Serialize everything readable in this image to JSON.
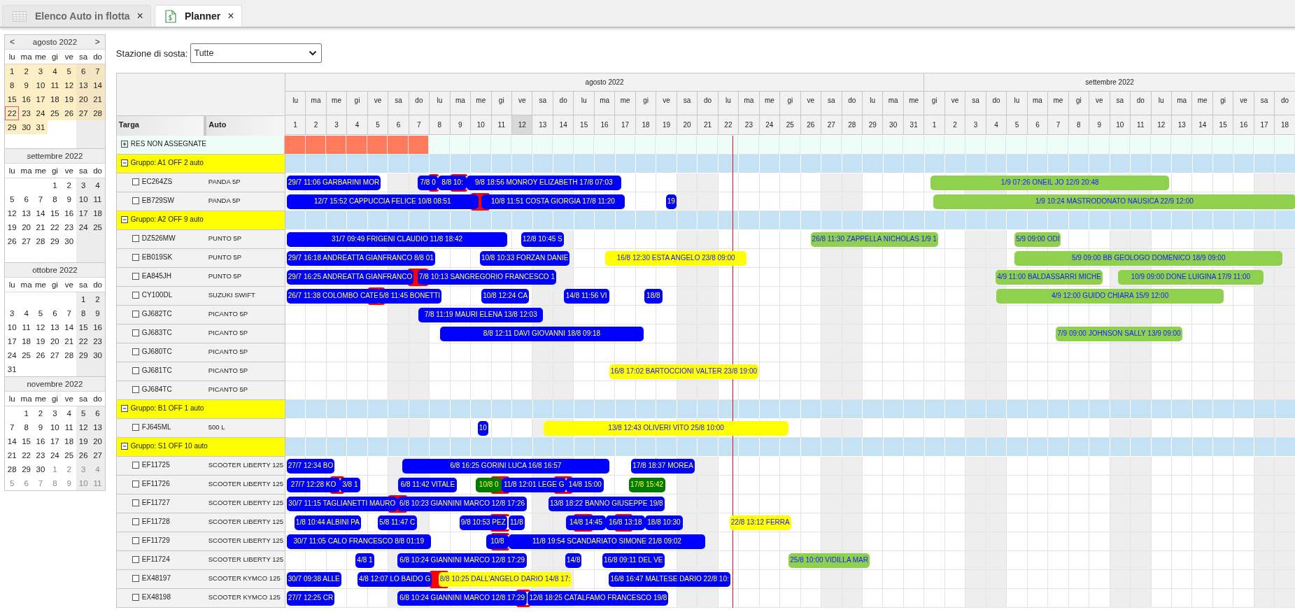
{
  "tabs": [
    {
      "label": "Elenco Auto in flotta",
      "kind": "table",
      "close": "×",
      "selected": false
    },
    {
      "label": "Planner",
      "kind": "sheet",
      "close": "×",
      "selected": true
    }
  ],
  "calendars": [
    {
      "title": "agosto 2022",
      "prev": "<",
      "next": ">",
      "highlighted": true,
      "weekdays": [
        "lu",
        "ma",
        "me",
        "gi",
        "ve",
        "sa",
        "do"
      ],
      "weeks": [
        [
          {
            "kind": "day",
            "day": "1"
          },
          {
            "kind": "day",
            "day": "2"
          },
          {
            "kind": "day",
            "day": "3"
          },
          {
            "kind": "day",
            "day": "4"
          },
          {
            "kind": "day",
            "day": "5"
          },
          {
            "kind": "day",
            "day": "6"
          },
          {
            "kind": "day",
            "day": "7"
          }
        ],
        [
          {
            "kind": "day",
            "day": "8"
          },
          {
            "kind": "day",
            "day": "9"
          },
          {
            "kind": "day",
            "day": "10"
          },
          {
            "kind": "day",
            "day": "11"
          },
          {
            "kind": "day",
            "day": "12"
          },
          {
            "kind": "day",
            "day": "13"
          },
          {
            "kind": "day",
            "day": "14"
          }
        ],
        [
          {
            "kind": "day",
            "day": "15"
          },
          {
            "kind": "day",
            "day": "16"
          },
          {
            "kind": "day",
            "day": "17"
          },
          {
            "kind": "day",
            "day": "18"
          },
          {
            "kind": "day",
            "day": "19"
          },
          {
            "kind": "day",
            "day": "20"
          },
          {
            "kind": "day",
            "day": "21"
          }
        ],
        [
          {
            "kind": "today",
            "day": "22"
          },
          {
            "kind": "day",
            "day": "23"
          },
          {
            "kind": "day",
            "day": "24"
          },
          {
            "kind": "day",
            "day": "25"
          },
          {
            "kind": "day",
            "day": "26"
          },
          {
            "kind": "day",
            "day": "27"
          },
          {
            "kind": "day",
            "day": "28"
          }
        ],
        [
          {
            "kind": "day",
            "day": "29"
          },
          {
            "kind": "day",
            "day": "30"
          },
          {
            "kind": "day",
            "day": "31"
          },
          {
            "kind": "blank"
          },
          {
            "kind": "blank"
          },
          {
            "kind": "blank"
          },
          {
            "kind": "blank"
          }
        ],
        [
          {
            "kind": "blank"
          },
          {
            "kind": "blank"
          },
          {
            "kind": "blank"
          },
          {
            "kind": "blank"
          },
          {
            "kind": "blank"
          },
          {
            "kind": "blank"
          },
          {
            "kind": "blank"
          }
        ]
      ]
    },
    {
      "title": "settembre 2022",
      "highlighted": false,
      "weekdays": [
        "lu",
        "ma",
        "me",
        "gi",
        "ve",
        "sa",
        "do"
      ],
      "weeks": [
        [
          {
            "kind": "blank"
          },
          {
            "kind": "blank"
          },
          {
            "kind": "blank"
          },
          {
            "kind": "day",
            "day": "1"
          },
          {
            "kind": "day",
            "day": "2"
          },
          {
            "kind": "day",
            "day": "3"
          },
          {
            "kind": "day",
            "day": "4"
          }
        ],
        [
          {
            "kind": "day",
            "day": "5"
          },
          {
            "kind": "day",
            "day": "6"
          },
          {
            "kind": "day",
            "day": "7"
          },
          {
            "kind": "day",
            "day": "8"
          },
          {
            "kind": "day",
            "day": "9"
          },
          {
            "kind": "day",
            "day": "10"
          },
          {
            "kind": "day",
            "day": "11"
          }
        ],
        [
          {
            "kind": "day",
            "day": "12"
          },
          {
            "kind": "day",
            "day": "13"
          },
          {
            "kind": "day",
            "day": "14"
          },
          {
            "kind": "day",
            "day": "15"
          },
          {
            "kind": "day",
            "day": "16"
          },
          {
            "kind": "day",
            "day": "17"
          },
          {
            "kind": "day",
            "day": "18"
          }
        ],
        [
          {
            "kind": "day",
            "day": "19"
          },
          {
            "kind": "day",
            "day": "20"
          },
          {
            "kind": "day",
            "day": "21"
          },
          {
            "kind": "day",
            "day": "22"
          },
          {
            "kind": "day",
            "day": "23"
          },
          {
            "kind": "day",
            "day": "24"
          },
          {
            "kind": "day",
            "day": "25"
          }
        ],
        [
          {
            "kind": "day",
            "day": "26"
          },
          {
            "kind": "day",
            "day": "27"
          },
          {
            "kind": "day",
            "day": "28"
          },
          {
            "kind": "day",
            "day": "29"
          },
          {
            "kind": "day",
            "day": "30"
          },
          {
            "kind": "blank"
          },
          {
            "kind": "blank"
          }
        ],
        [
          {
            "kind": "blank"
          },
          {
            "kind": "blank"
          },
          {
            "kind": "blank"
          },
          {
            "kind": "blank"
          },
          {
            "kind": "blank"
          },
          {
            "kind": "blank"
          },
          {
            "kind": "blank"
          }
        ]
      ]
    },
    {
      "title": "ottobre 2022",
      "highlighted": false,
      "weekdays": [
        "lu",
        "ma",
        "me",
        "gi",
        "ve",
        "sa",
        "do"
      ],
      "weeks": [
        [
          {
            "kind": "blank"
          },
          {
            "kind": "blank"
          },
          {
            "kind": "blank"
          },
          {
            "kind": "blank"
          },
          {
            "kind": "blank"
          },
          {
            "kind": "day",
            "day": "1"
          },
          {
            "kind": "day",
            "day": "2"
          }
        ],
        [
          {
            "kind": "day",
            "day": "3"
          },
          {
            "kind": "day",
            "day": "4"
          },
          {
            "kind": "day",
            "day": "5"
          },
          {
            "kind": "day",
            "day": "6"
          },
          {
            "kind": "day",
            "day": "7"
          },
          {
            "kind": "day",
            "day": "8"
          },
          {
            "kind": "day",
            "day": "9"
          }
        ],
        [
          {
            "kind": "day",
            "day": "10"
          },
          {
            "kind": "day",
            "day": "11"
          },
          {
            "kind": "day",
            "day": "12"
          },
          {
            "kind": "day",
            "day": "13"
          },
          {
            "kind": "day",
            "day": "14"
          },
          {
            "kind": "day",
            "day": "15"
          },
          {
            "kind": "day",
            "day": "16"
          }
        ],
        [
          {
            "kind": "day",
            "day": "17"
          },
          {
            "kind": "day",
            "day": "18"
          },
          {
            "kind": "day",
            "day": "19"
          },
          {
            "kind": "day",
            "day": "20"
          },
          {
            "kind": "day",
            "day": "21"
          },
          {
            "kind": "day",
            "day": "22"
          },
          {
            "kind": "day",
            "day": "23"
          }
        ],
        [
          {
            "kind": "day",
            "day": "24"
          },
          {
            "kind": "day",
            "day": "25"
          },
          {
            "kind": "day",
            "day": "26"
          },
          {
            "kind": "day",
            "day": "27"
          },
          {
            "kind": "day",
            "day": "28"
          },
          {
            "kind": "day",
            "day": "29"
          },
          {
            "kind": "day",
            "day": "30"
          }
        ],
        [
          {
            "kind": "day",
            "day": "31"
          },
          {
            "kind": "blank"
          },
          {
            "kind": "blank"
          },
          {
            "kind": "blank"
          },
          {
            "kind": "blank"
          },
          {
            "kind": "blank"
          },
          {
            "kind": "blank"
          }
        ]
      ]
    },
    {
      "title": "novembre 2022",
      "highlighted": false,
      "weekdays": [
        "lu",
        "ma",
        "me",
        "gi",
        "ve",
        "sa",
        "do"
      ],
      "weeks": [
        [
          {
            "kind": "blank"
          },
          {
            "kind": "day",
            "day": "1"
          },
          {
            "kind": "day",
            "day": "2"
          },
          {
            "kind": "day",
            "day": "3"
          },
          {
            "kind": "day",
            "day": "4"
          },
          {
            "kind": "day",
            "day": "5"
          },
          {
            "kind": "day",
            "day": "6"
          }
        ],
        [
          {
            "kind": "day",
            "day": "7"
          },
          {
            "kind": "day",
            "day": "8"
          },
          {
            "kind": "day",
            "day": "9"
          },
          {
            "kind": "day",
            "day": "10"
          },
          {
            "kind": "day",
            "day": "11"
          },
          {
            "kind": "day",
            "day": "12"
          },
          {
            "kind": "day",
            "day": "13"
          }
        ],
        [
          {
            "kind": "day",
            "day": "14"
          },
          {
            "kind": "day",
            "day": "15"
          },
          {
            "kind": "day",
            "day": "16"
          },
          {
            "kind": "day",
            "day": "17"
          },
          {
            "kind": "day",
            "day": "18"
          },
          {
            "kind": "day",
            "day": "19"
          },
          {
            "kind": "day",
            "day": "20"
          }
        ],
        [
          {
            "kind": "day",
            "day": "21"
          },
          {
            "kind": "day",
            "day": "22"
          },
          {
            "kind": "day",
            "day": "23"
          },
          {
            "kind": "day",
            "day": "24"
          },
          {
            "kind": "day",
            "day": "25"
          },
          {
            "kind": "day",
            "day": "26"
          },
          {
            "kind": "day",
            "day": "27"
          }
        ],
        [
          {
            "kind": "day",
            "day": "28"
          },
          {
            "kind": "day",
            "day": "29"
          },
          {
            "kind": "day",
            "day": "30"
          },
          {
            "kind": "other",
            "day": "1"
          },
          {
            "kind": "other",
            "day": "2"
          },
          {
            "kind": "other",
            "day": "3"
          },
          {
            "kind": "other",
            "day": "4"
          }
        ],
        [
          {
            "kind": "other",
            "day": "5"
          },
          {
            "kind": "other",
            "day": "6"
          },
          {
            "kind": "other",
            "day": "7"
          },
          {
            "kind": "other",
            "day": "8"
          },
          {
            "kind": "other",
            "day": "9"
          },
          {
            "kind": "other",
            "day": "10"
          },
          {
            "kind": "other",
            "day": "11"
          }
        ]
      ]
    }
  ],
  "filter": {
    "label": "Stazione di sosta:",
    "value": "Tutte"
  },
  "planner": {
    "columns": [
      "Targa",
      "Auto"
    ],
    "months": [
      {
        "label": "agosto 2022",
        "days": [
          {
            "weekday": "lu",
            "day": "1",
            "highlighted": false,
            "weekend": false
          },
          {
            "weekday": "ma",
            "day": "2",
            "highlighted": false,
            "weekend": false
          },
          {
            "weekday": "me",
            "day": "3",
            "highlighted": false,
            "weekend": false
          },
          {
            "weekday": "gi",
            "day": "4",
            "highlighted": false,
            "weekend": false
          },
          {
            "weekday": "ve",
            "day": "5",
            "highlighted": false,
            "weekend": false
          },
          {
            "weekday": "sa",
            "day": "6",
            "highlighted": false,
            "weekend": true
          },
          {
            "weekday": "do",
            "day": "7",
            "highlighted": false,
            "weekend": true
          },
          {
            "weekday": "lu",
            "day": "8",
            "highlighted": false,
            "weekend": false
          },
          {
            "weekday": "ma",
            "day": "9",
            "highlighted": false,
            "weekend": false
          },
          {
            "weekday": "me",
            "day": "10",
            "highlighted": false,
            "weekend": false
          },
          {
            "weekday": "gi",
            "day": "11",
            "highlighted": false,
            "weekend": false
          },
          {
            "weekday": "ve",
            "day": "12",
            "highlighted": true,
            "weekend": false
          },
          {
            "weekday": "sa",
            "day": "13",
            "highlighted": false,
            "weekend": true
          },
          {
            "weekday": "do",
            "day": "14",
            "highlighted": false,
            "weekend": true
          },
          {
            "weekday": "lu",
            "day": "15",
            "highlighted": false,
            "weekend": false
          },
          {
            "weekday": "ma",
            "day": "16",
            "highlighted": false,
            "weekend": false
          },
          {
            "weekday": "me",
            "day": "17",
            "highlighted": false,
            "weekend": false
          },
          {
            "weekday": "gi",
            "day": "18",
            "highlighted": false,
            "weekend": false
          },
          {
            "weekday": "ve",
            "day": "19",
            "highlighted": false,
            "weekend": false
          },
          {
            "weekday": "sa",
            "day": "20",
            "highlighted": false,
            "weekend": true
          },
          {
            "weekday": "do",
            "day": "21",
            "highlighted": false,
            "weekend": true
          },
          {
            "weekday": "lu",
            "day": "22",
            "highlighted": false,
            "weekend": false
          },
          {
            "weekday": "ma",
            "day": "23",
            "highlighted": false,
            "weekend": false
          },
          {
            "weekday": "me",
            "day": "24",
            "highlighted": false,
            "weekend": false
          },
          {
            "weekday": "gi",
            "day": "25",
            "highlighted": false,
            "weekend": false
          },
          {
            "weekday": "ve",
            "day": "26",
            "highlighted": false,
            "weekend": false
          },
          {
            "weekday": "sa",
            "day": "27",
            "highlighted": false,
            "weekend": true
          },
          {
            "weekday": "do",
            "day": "28",
            "highlighted": false,
            "weekend": true
          },
          {
            "weekday": "lu",
            "day": "29",
            "highlighted": false,
            "weekend": false
          },
          {
            "weekday": "ma",
            "day": "30",
            "highlighted": false,
            "weekend": false
          },
          {
            "weekday": "me",
            "day": "31",
            "highlighted": false,
            "weekend": false
          }
        ]
      },
      {
        "label": "settembre 2022",
        "days": [
          {
            "weekday": "gi",
            "day": "1",
            "highlighted": false,
            "weekend": false
          },
          {
            "weekday": "ve",
            "day": "2",
            "highlighted": false,
            "weekend": false
          },
          {
            "weekday": "sa",
            "day": "3",
            "highlighted": false,
            "weekend": true
          },
          {
            "weekday": "do",
            "day": "4",
            "highlighted": false,
            "weekend": true
          },
          {
            "weekday": "lu",
            "day": "5",
            "highlighted": false,
            "weekend": false
          },
          {
            "weekday": "ma",
            "day": "6",
            "highlighted": false,
            "weekend": false
          },
          {
            "weekday": "me",
            "day": "7",
            "highlighted": false,
            "weekend": false
          },
          {
            "weekday": "gi",
            "day": "8",
            "highlighted": false,
            "weekend": false
          },
          {
            "weekday": "ve",
            "day": "9",
            "highlighted": false,
            "weekend": false
          },
          {
            "weekday": "sa",
            "day": "10",
            "highlighted": false,
            "weekend": true
          },
          {
            "weekday": "do",
            "day": "11",
            "highlighted": false,
            "weekend": true
          },
          {
            "weekday": "lu",
            "day": "12",
            "highlighted": false,
            "weekend": false
          },
          {
            "weekday": "ma",
            "day": "13",
            "highlighted": false,
            "weekend": false
          },
          {
            "weekday": "me",
            "day": "14",
            "highlighted": false,
            "weekend": false
          },
          {
            "weekday": "gi",
            "day": "15",
            "highlighted": false,
            "weekend": false
          },
          {
            "weekday": "ve",
            "day": "16",
            "highlighted": false,
            "weekend": false
          },
          {
            "weekday": "sa",
            "day": "17",
            "highlighted": false,
            "weekend": true
          },
          {
            "weekday": "do",
            "day": "18",
            "highlighted": false,
            "weekend": true
          }
        ]
      }
    ],
    "rows": [
      {
        "kind": "unassigned",
        "label": "RES NON ASSEGNATE",
        "expanded": false,
        "cells": [
          {
            "alert": true
          },
          {
            "alert": true
          },
          {
            "alert": true
          },
          {
            "alert": true
          },
          {
            "alert": true
          },
          {
            "alert": true
          },
          {
            "alert": true
          },
          {
            "alert": false
          },
          {
            "alert": false
          },
          {
            "alert": false
          },
          {
            "alert": false
          },
          {
            "alert": false
          },
          {
            "alert": false
          },
          {
            "alert": false
          },
          {
            "alert": false
          },
          {
            "alert": false
          },
          {
            "alert": false
          },
          {
            "alert": false
          },
          {
            "alert": false
          },
          {
            "alert": false
          },
          {
            "alert": false
          },
          {
            "alert": false
          },
          {
            "alert": false
          },
          {
            "alert": false
          },
          {
            "alert": false
          },
          {
            "alert": false
          },
          {
            "alert": false
          },
          {
            "alert": false
          },
          {
            "alert": false
          },
          {
            "alert": false
          },
          {
            "alert": false
          },
          {
            "alert": false
          },
          {
            "alert": false
          },
          {
            "alert": false
          },
          {
            "alert": false
          },
          {
            "alert": false
          },
          {
            "alert": false
          },
          {
            "alert": false
          },
          {
            "alert": false
          },
          {
            "alert": false
          },
          {
            "alert": false
          },
          {
            "alert": false
          },
          {
            "alert": false
          },
          {
            "alert": false
          },
          {
            "alert": false
          },
          {
            "alert": false
          },
          {
            "alert": false
          },
          {
            "alert": false
          },
          {
            "alert": false
          }
        ]
      },
      {
        "kind": "group",
        "label": "Gruppo: A1 OFF 2 auto",
        "expanded": true
      },
      {
        "kind": "vehicle",
        "plate": "EC264ZS",
        "model": "PANDA 5P",
        "checked": false,
        "bars": [
          {
            "label": "29/7 11:06 GARBARINI MOR",
            "color": "#0000ff"
          },
          {
            "label": "7/8 0",
            "color": "#0000ff"
          },
          {
            "label": "8/8 10:",
            "color": "#0000ff"
          },
          {
            "label": "9/8 18:56 MONROY ELIZABETH 17/8 07:03",
            "color": "#0000ff"
          },
          {
            "label": "1/9 07:26 ONEIL JO 12/9 20:48",
            "color": "#8fd14f"
          }
        ],
        "conflicts": [
          {
            "kind": "bracket"
          },
          {
            "kind": "bracket"
          }
        ]
      },
      {
        "kind": "vehicle",
        "plate": "EB729SW",
        "model": "PANDA 5P",
        "checked": false,
        "bars": [
          {
            "label": "12/7 15:52 CAPPUCCIA FELICE 10/8 08:51",
            "color": "#0000ff"
          },
          {
            "label": "10/8 11:51 COSTA GIORGIA 17/8 11:20",
            "color": "#0000ff"
          },
          {
            "label": "19",
            "color": "#0000ff"
          },
          {
            "label": "1/9 10:24 MASTRODONATO NAUSICA 22/9 12:00",
            "color": "#8fd14f"
          }
        ],
        "conflicts": [
          {
            "kind": "bracket"
          }
        ]
      },
      {
        "kind": "group",
        "label": "Gruppo: A2 OFF 9 auto",
        "expanded": true
      },
      {
        "kind": "vehicle",
        "plate": "DZ526MW",
        "model": "PUNTO 5P",
        "checked": false,
        "bars": [
          {
            "label": "31/7 09:49 FRIGENI CLAUDIO 11/8 18:42",
            "color": "#0000ff"
          },
          {
            "label": "12/8 10:45 S",
            "color": "#0000ff"
          },
          {
            "label": "26/8 11:30 ZAPPELLA NICHOLAS 1/9 1",
            "color": "#8fd14f"
          },
          {
            "label": "5/9 09:00 ODI",
            "color": "#8fd14f"
          }
        ]
      },
      {
        "kind": "vehicle",
        "plate": "EB019SK",
        "model": "PUNTO 5P",
        "checked": false,
        "bars": [
          {
            "label": "29/7 16:18 ANDREATTA GIANFRANCO 8/8 01",
            "color": "#0000ff"
          },
          {
            "label": "10/8 10:33 FORZAN DANIE",
            "color": "#0000ff"
          },
          {
            "label": "16/8 12:30 ESTA ANGELO 23/8 09:00",
            "color": "#ffff00"
          },
          {
            "label": "5/9 09:00 BB GEOLOGO DOMENICO 18/9 09:00",
            "color": "#8fd14f"
          }
        ]
      },
      {
        "kind": "vehicle",
        "plate": "EA845JH",
        "model": "PUNTO 5P",
        "checked": false,
        "bars": [
          {
            "label": "29/7 16:25 ANDREATTA GIANFRANCO",
            "color": "#0000ff"
          },
          {
            "label": "7/8 10:13 SANGREGORIO FRANCESCO 1",
            "color": "#0000ff"
          },
          {
            "label": "4/9 11:00 BALDASSARRI MICHE",
            "color": "#8fd14f"
          },
          {
            "label": "10/9 09:00 DONE LUIGINA 17/9 11:00",
            "color": "#8fd14f"
          }
        ],
        "conflicts": [
          {
            "kind": "block"
          }
        ]
      },
      {
        "kind": "vehicle",
        "plate": "CY100DL",
        "model": "SUZUKI SWIFT",
        "checked": false,
        "bars": [
          {
            "label": "26/7 11:38 COLOMBO CATE",
            "color": "#0000ff"
          },
          {
            "label": "5/8 11:45 BONETTI",
            "color": "#0000ff"
          },
          {
            "label": "10/8 12:24 CA",
            "color": "#0000ff"
          },
          {
            "label": "14/8 11:56 VI",
            "color": "#0000ff"
          },
          {
            "label": "18/8",
            "color": "#0000ff"
          },
          {
            "label": "4/9 12:00 GUIDO CHIARA 15/9 12:00",
            "color": "#8fd14f"
          }
        ],
        "conflicts": [
          {
            "kind": "bracket"
          }
        ]
      },
      {
        "kind": "vehicle",
        "plate": "GJ682TC",
        "model": "PICANTO 5P",
        "checked": false,
        "bars": [
          {
            "label": "7/8 11:19 MAURI ELENA 13/8 12:03",
            "color": "#0000ff"
          }
        ]
      },
      {
        "kind": "vehicle",
        "plate": "GJ683TC",
        "model": "PICANTO 5P",
        "checked": false,
        "bars": [
          {
            "label": "8/8 12:11 DAVI GIOVANNI 18/8 09:18",
            "color": "#0000ff"
          },
          {
            "label": "7/9 09:00 JOHNSON SALLY 13/9 09:00",
            "color": "#8fd14f"
          }
        ]
      },
      {
        "kind": "vehicle",
        "plate": "GJ680TC",
        "model": "PICANTO 5P",
        "checked": false
      },
      {
        "kind": "vehicle",
        "plate": "GJ681TC",
        "model": "PICANTO 5P",
        "checked": false,
        "bars": [
          {
            "label": "16/8 17:02 BARTOCCIONI VALTER 23/8 19:00",
            "color": "#ffff00"
          }
        ]
      },
      {
        "kind": "vehicle",
        "plate": "GJ684TC",
        "model": "PICANTO 5P",
        "checked": false
      },
      {
        "kind": "group",
        "label": "Gruppo: B1 OFF 1 auto",
        "expanded": true
      },
      {
        "kind": "vehicle",
        "plate": "FJ645ML",
        "model": "500 L",
        "checked": false,
        "bars": [
          {
            "label": "10",
            "color": "#0000ff"
          },
          {
            "label": "13/8 12:43 OLIVERI VITO 25/8 10:00",
            "color": "#ffff00"
          }
        ]
      },
      {
        "kind": "group",
        "label": "Gruppo: S1 OFF 10 auto",
        "expanded": true
      },
      {
        "kind": "vehicle",
        "plate": "EF11725",
        "model": "SCOOTER LIBERTY 125",
        "checked": false,
        "bars": [
          {
            "label": "27/7 12:34 BO",
            "color": "#0000ff"
          },
          {
            "label": "6/8 16:25 GORINI LUCA 16/8 16:57",
            "color": "#0000ff"
          },
          {
            "label": "17/8 18:37 MOREA",
            "color": "#0000ff"
          }
        ]
      },
      {
        "kind": "vehicle",
        "plate": "EF11726",
        "model": "SCOOTER LIBERTY 125",
        "checked": false,
        "bars": [
          {
            "label": "27/7 12:28 KO",
            "color": "#0000ff"
          },
          {
            "label": "3/8 1",
            "color": "#0000ff"
          },
          {
            "label": "6/8 11:42 VITALE",
            "color": "#0000ff"
          },
          {
            "label": "10/8 0",
            "color": "#007a00"
          },
          {
            "label": "11/8 12:01 LEGE G",
            "color": "#0000ff"
          },
          {
            "label": "14/8 15:00",
            "color": "#0000ff"
          },
          {
            "label": "17/8 15:42",
            "color": "#007a00"
          }
        ],
        "conflicts": [
          {
            "kind": "bracket"
          },
          {
            "kind": "bracket"
          },
          {
            "kind": "bracket"
          }
        ]
      },
      {
        "kind": "vehicle",
        "plate": "EF11727",
        "model": "SCOOTER LIBERTY 125",
        "checked": false,
        "bars": [
          {
            "label": "30/7 11:15 TAGLIANETTI MAURO",
            "color": "#0000ff"
          },
          {
            "label": "6/8 10:23 GIANNINI MARCO 12/8 17:26",
            "color": "#0000ff"
          },
          {
            "label": "13/8 18:22 BANNO GIUSEPPE 19/8",
            "color": "#0000ff"
          }
        ],
        "conflicts": [
          {
            "kind": "bracket"
          }
        ]
      },
      {
        "kind": "vehicle",
        "plate": "EF11728",
        "model": "SCOOTER LIBERTY 125",
        "checked": false,
        "bars": [
          {
            "label": "1/8 10:44 ALBINI PA",
            "color": "#0000ff"
          },
          {
            "label": "5/8 11:47 C",
            "color": "#0000ff"
          },
          {
            "label": "9/8 10:53 PEZ",
            "color": "#0000ff"
          },
          {
            "label": "11/8",
            "color": "#0000ff"
          },
          {
            "label": "14/8 14:45",
            "color": "#0000ff"
          },
          {
            "label": "16/8 13:18",
            "color": "#0000ff"
          },
          {
            "label": "18/8 10:30",
            "color": "#0000ff"
          },
          {
            "label": "22/8 13:12 FERRA",
            "color": "#ffff00"
          }
        ],
        "conflicts": [
          {
            "kind": "bracket"
          },
          {
            "kind": "bracket"
          },
          {
            "kind": "bracket"
          }
        ]
      },
      {
        "kind": "vehicle",
        "plate": "EF11729",
        "model": "SCOOTER LIBERTY 125",
        "checked": false,
        "bars": [
          {
            "label": "30/7 11:05 CALO FRANCESCO 8/8 01:19",
            "color": "#0000ff"
          },
          {
            "label": "10/8",
            "color": "#0000ff"
          },
          {
            "label": "11/8 19:54 SCANDARIATO SIMONE 21/8 09:02",
            "color": "#0000ff"
          }
        ],
        "conflicts": [
          {
            "kind": "bracket"
          }
        ]
      },
      {
        "kind": "vehicle",
        "plate": "EF11724",
        "model": "SCOOTER LIBERTY 125",
        "checked": false,
        "bars": [
          {
            "label": "4/8 1",
            "color": "#0000ff"
          },
          {
            "label": "6/8 10:24 GIANNINI MARCO 12/8 17:29",
            "color": "#0000ff"
          },
          {
            "label": "14/8",
            "color": "#0000ff"
          },
          {
            "label": "16/8 09:11 DEL VE",
            "color": "#0000ff"
          },
          {
            "label": "25/8 10:00 VIDILLA MAR",
            "color": "#8fd14f"
          }
        ]
      },
      {
        "kind": "vehicle",
        "plate": "EX48197",
        "model": "SCOOTER KYMCO 125",
        "checked": false,
        "bars": [
          {
            "label": "30/7 09:38 ALLE",
            "color": "#0000ff"
          },
          {
            "label": "4/8 12:07 LO BAIDO G",
            "color": "#0000ff"
          },
          {
            "label": "8/8 10:25 DALL'ANGELO DARIO 14/8 17:",
            "color": "#ffff00"
          },
          {
            "label": "16/8 16:47 MALTESE DARIO 22/8 10:",
            "color": "#0000ff"
          }
        ],
        "conflicts": [
          {
            "kind": "block"
          }
        ]
      },
      {
        "kind": "vehicle",
        "plate": "EX48198",
        "model": "SCOOTER KYMCO 125",
        "checked": false,
        "bars": [
          {
            "label": "27/7 12:25 CR",
            "color": "#0000ff"
          },
          {
            "label": "6/8 10:24 GIANNINI MARCO 12/8 17:29",
            "color": "#0000ff"
          },
          {
            "label": "12/8 18:25 CATALFAMO FRANCESCO 19/8",
            "color": "#0000ff"
          }
        ],
        "conflicts": [
          {
            "kind": "bracket"
          }
        ]
      }
    ]
  }
}
